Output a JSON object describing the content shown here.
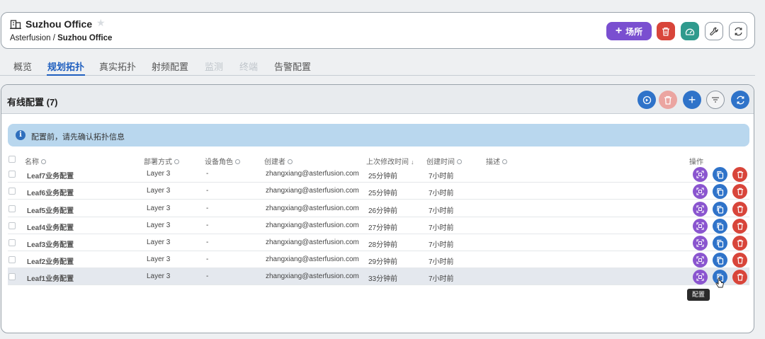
{
  "header": {
    "title": "Suzhou Office",
    "breadcrumb_root": "Asterfusion",
    "breadcrumb_sep": " / ",
    "breadcrumb_current": "Suzhou Office",
    "add_site_label": "场所",
    "star_glyph": "★"
  },
  "tabs": [
    {
      "label": "概览",
      "state": "normal"
    },
    {
      "label": "规划拓扑",
      "state": "active"
    },
    {
      "label": "真实拓扑",
      "state": "normal"
    },
    {
      "label": "射频配置",
      "state": "normal"
    },
    {
      "label": "监测",
      "state": "disabled"
    },
    {
      "label": "终端",
      "state": "disabled"
    },
    {
      "label": "告警配置",
      "state": "normal"
    }
  ],
  "panel": {
    "title": "有线配置 (7)",
    "add_glyph": "+"
  },
  "alert": {
    "icon_glyph": "i",
    "text": "配置前，请先确认拓扑信息"
  },
  "table": {
    "headers": {
      "name": "名称",
      "deploy": "部署方式",
      "role": "设备角色",
      "creator": "创建者",
      "modified": "上次修改时间",
      "sort_arrow": "↓",
      "created": "创建时间",
      "desc": "描述",
      "ops": "操作"
    },
    "rows": [
      {
        "name": "Leaf7业务配置",
        "deploy": "Layer 3",
        "role": "-",
        "creator": "zhangxiang@asterfusion.com",
        "modified": "25分钟前",
        "created": "7小时前"
      },
      {
        "name": "Leaf6业务配置",
        "deploy": "Layer 3",
        "role": "-",
        "creator": "zhangxiang@asterfusion.com",
        "modified": "25分钟前",
        "created": "7小时前"
      },
      {
        "name": "Leaf5业务配置",
        "deploy": "Layer 3",
        "role": "-",
        "creator": "zhangxiang@asterfusion.com",
        "modified": "26分钟前",
        "created": "7小时前"
      },
      {
        "name": "Leaf4业务配置",
        "deploy": "Layer 3",
        "role": "-",
        "creator": "zhangxiang@asterfusion.com",
        "modified": "27分钟前",
        "created": "7小时前"
      },
      {
        "name": "Leaf3业务配置",
        "deploy": "Layer 3",
        "role": "-",
        "creator": "zhangxiang@asterfusion.com",
        "modified": "28分钟前",
        "created": "7小时前"
      },
      {
        "name": "Leaf2业务配置",
        "deploy": "Layer 3",
        "role": "-",
        "creator": "zhangxiang@asterfusion.com",
        "modified": "29分钟前",
        "created": "7小时前"
      },
      {
        "name": "Leaf1业务配置",
        "deploy": "Layer 3",
        "role": "-",
        "creator": "zhangxiang@asterfusion.com",
        "modified": "33分钟前",
        "created": "7小时前"
      }
    ]
  },
  "tooltip": {
    "text": "配置"
  },
  "colors": {
    "accent_blue": "#2f73c9",
    "purple": "#8a55cf",
    "danger": "#d8453a",
    "teal": "#2f9a8d"
  },
  "icons": {
    "site": "building-icon",
    "favorite": "star-icon",
    "delete": "trash-icon",
    "dashboard": "gauge-icon",
    "tools": "wrench-icon",
    "reload": "refresh-icon",
    "history": "history-icon",
    "filter": "filter-icon",
    "config": "scan-icon",
    "copy": "copy-icon"
  }
}
